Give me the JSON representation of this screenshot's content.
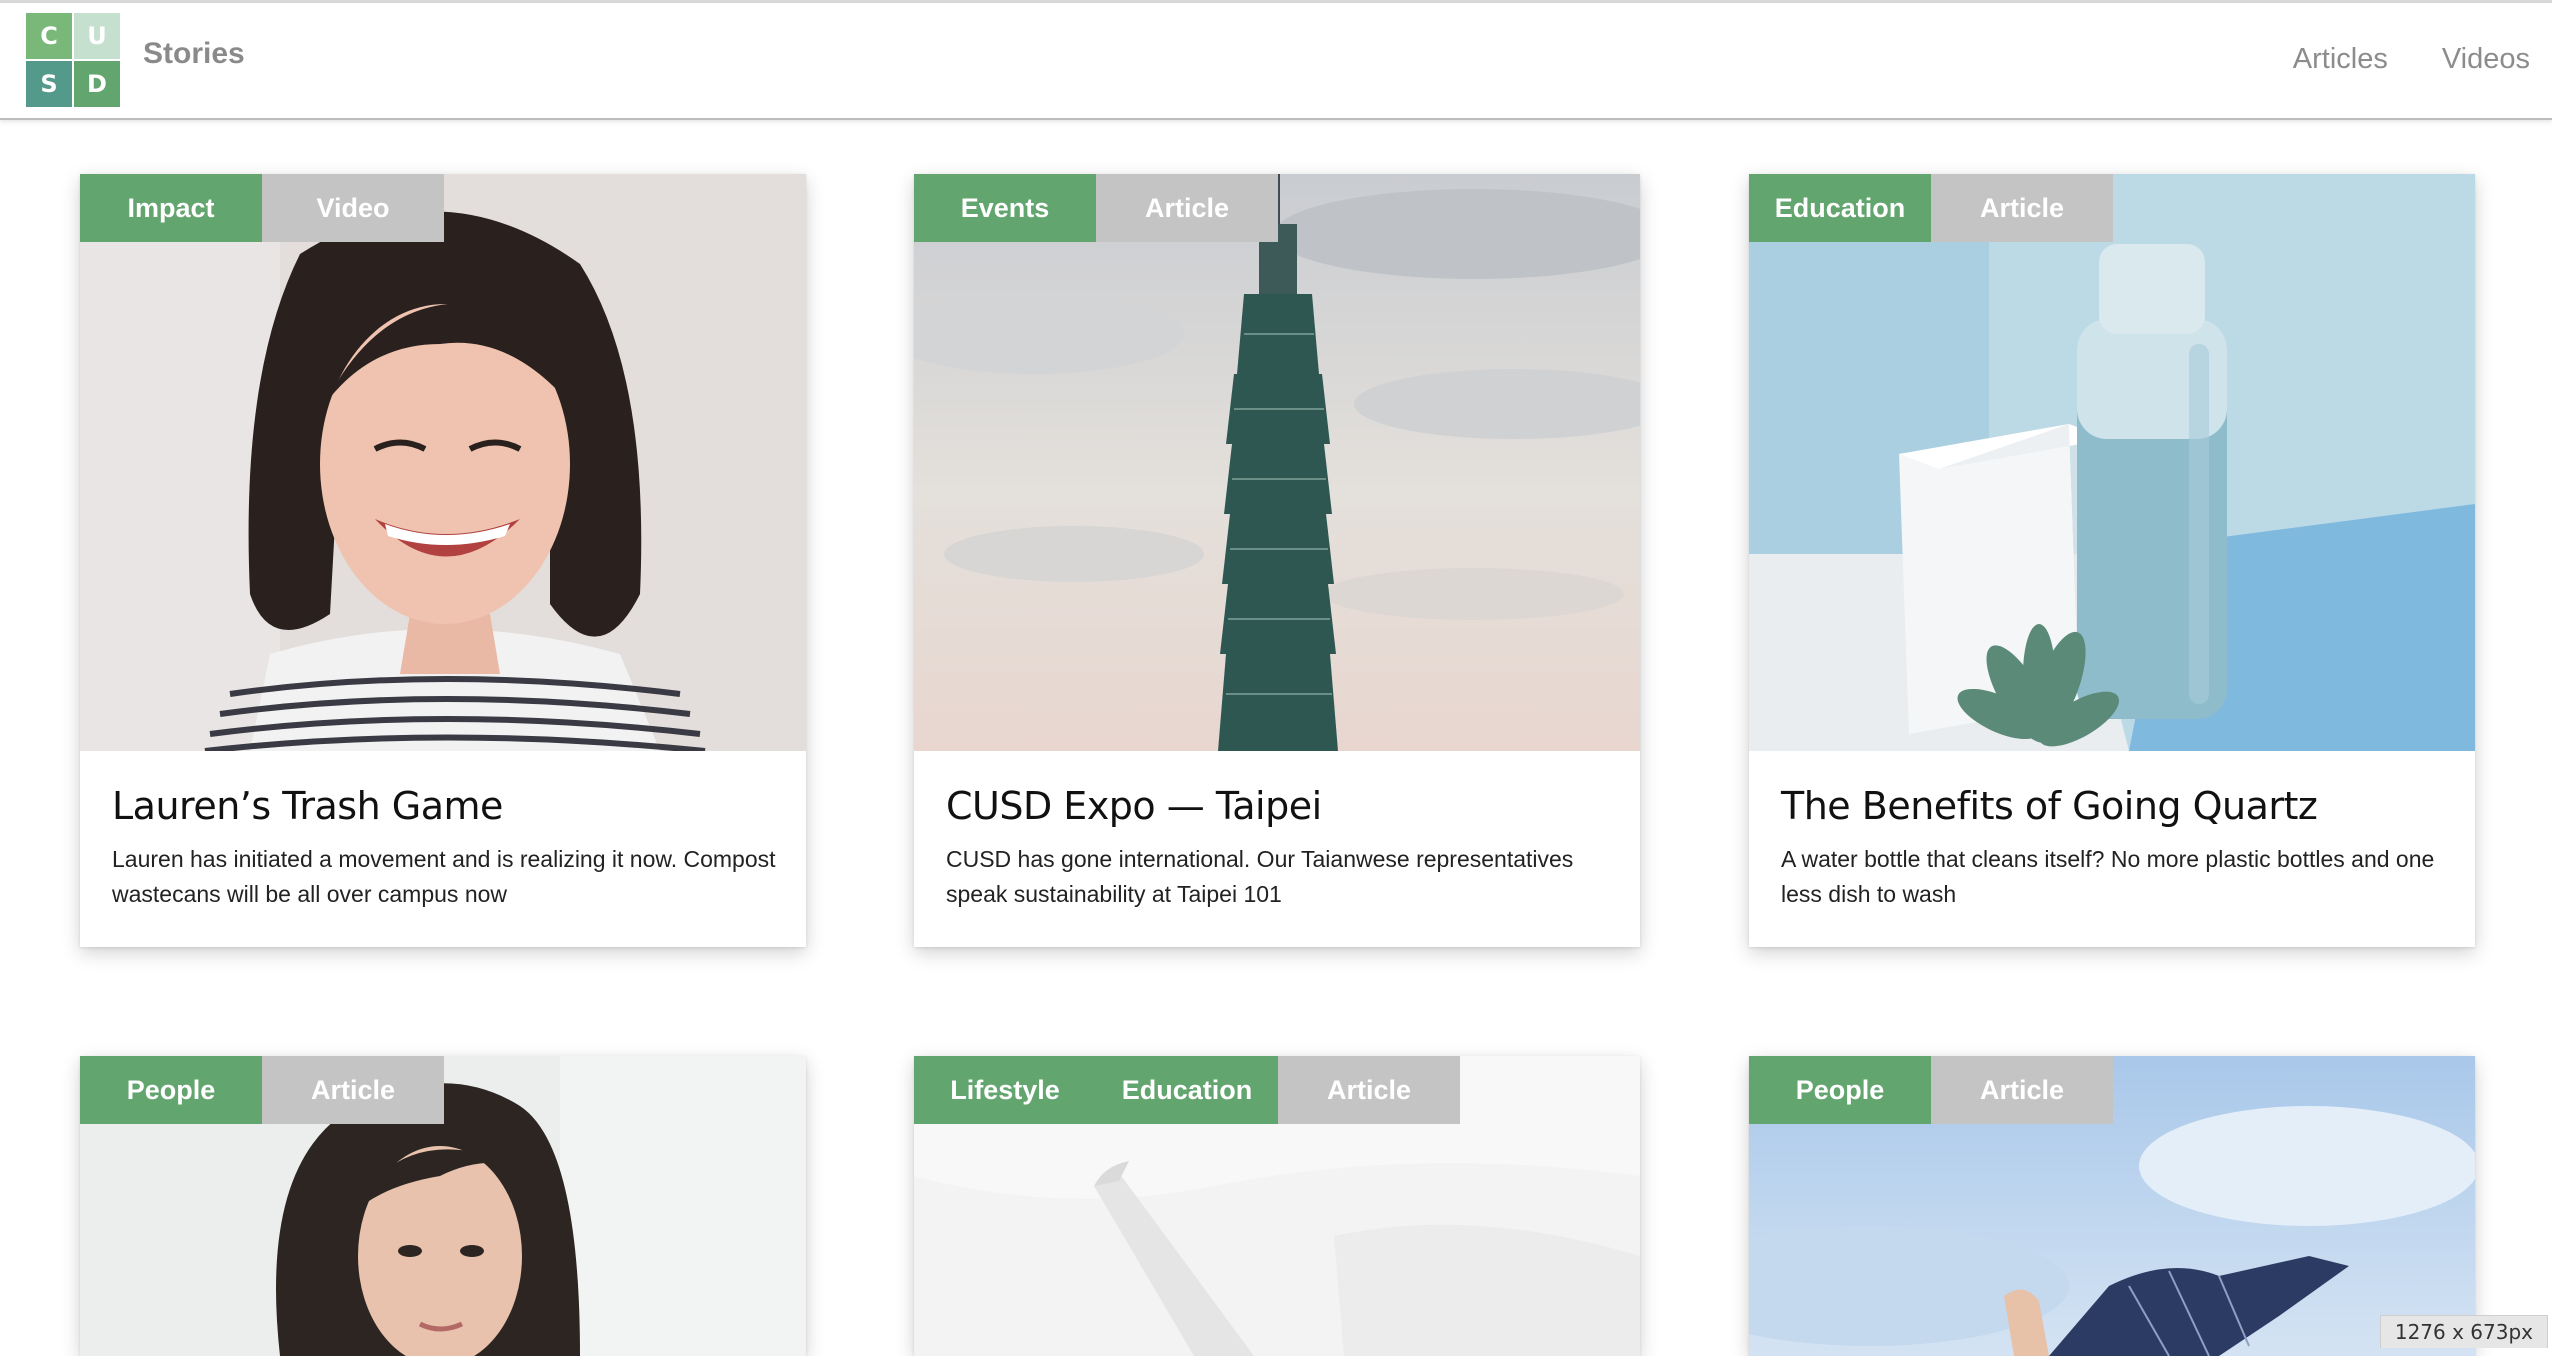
{
  "app": {
    "brand": "Stories",
    "logo_letters": [
      "C",
      "U",
      "S",
      "D"
    ],
    "logo_colors": [
      "#79b879",
      "#c5e0cf",
      "#549a8a",
      "#63a56f"
    ]
  },
  "nav": {
    "items": [
      "Articles",
      "Videos"
    ]
  },
  "cards": [
    {
      "tags": [
        "Impact"
      ],
      "type": "Video",
      "title": "Lauren’s Trash Game",
      "description": "Lauren has initiated a movement and is realizing it now. Compost wastecans will be all over campus now",
      "image": "portrait-smiling-woman"
    },
    {
      "tags": [
        "Events"
      ],
      "type": "Article",
      "title": "CUSD Expo — Taipei",
      "description": "CUSD has gone international. Our Taianwese representatives speak sustainability at Taipei 101",
      "image": "taipei-101-tower"
    },
    {
      "tags": [
        "Education"
      ],
      "type": "Article",
      "title": "The Benefits of Going Quartz",
      "description": "A water bottle that cleans itself? No more plastic bottles and one less dish to wash",
      "image": "water-bottle-still-life"
    },
    {
      "tags": [
        "People"
      ],
      "type": "Article",
      "image": "portrait-woman"
    },
    {
      "tags": [
        "Lifestyle",
        "Education"
      ],
      "type": "Article",
      "image": "white-sheets"
    },
    {
      "tags": [
        "People"
      ],
      "type": "Article",
      "image": "sky-jump"
    }
  ],
  "viewport_badge": "1276 x 673px",
  "colors": {
    "tag_green": "#63a56f",
    "tag_gray": "#c4c4c4",
    "nav_text": "#8c8c8c"
  }
}
